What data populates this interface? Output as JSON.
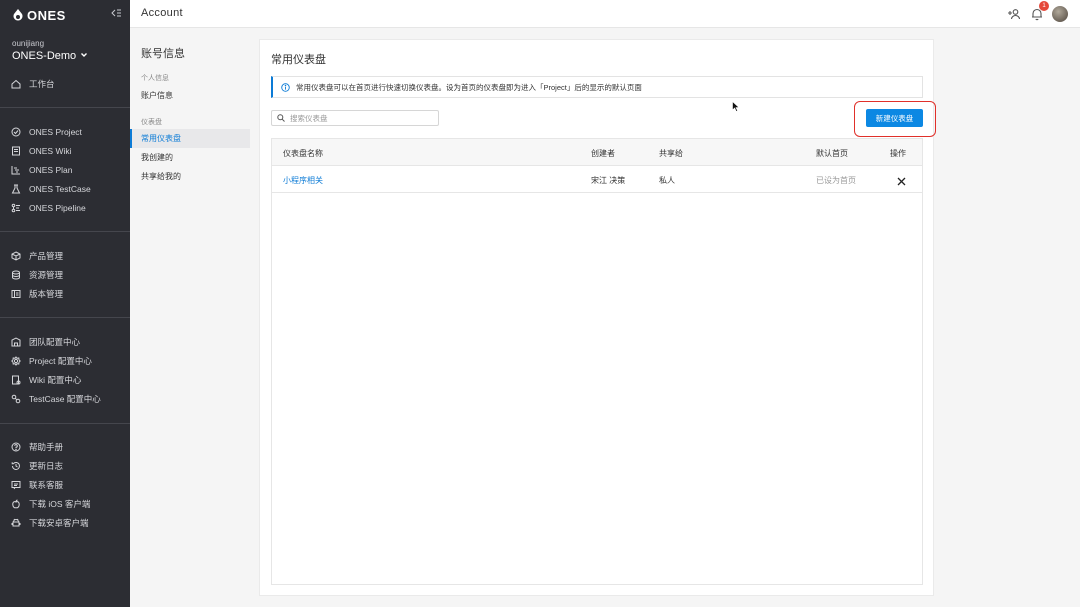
{
  "sidebar": {
    "logo_text": "ONES",
    "user_name": "ounijiang",
    "org_name": "ONES-Demo",
    "items": [
      {
        "label": "工作台",
        "icon": "home-icon"
      },
      {
        "label": "ONES Project",
        "icon": "project-icon"
      },
      {
        "label": "ONES Wiki",
        "icon": "wiki-icon"
      },
      {
        "label": "ONES Plan",
        "icon": "plan-icon"
      },
      {
        "label": "ONES TestCase",
        "icon": "testcase-icon"
      },
      {
        "label": "ONES Pipeline",
        "icon": "pipeline-icon"
      },
      {
        "label": "产品管理",
        "icon": "product-icon"
      },
      {
        "label": "资源管理",
        "icon": "resource-icon"
      },
      {
        "label": "版本管理",
        "icon": "version-icon"
      },
      {
        "label": "团队配置中心",
        "icon": "team-config-icon"
      },
      {
        "label": "Project 配置中心",
        "icon": "settings-icon"
      },
      {
        "label": "Wiki 配置中心",
        "icon": "wiki-config-icon"
      },
      {
        "label": "TestCase 配置中心",
        "icon": "testcase-config-icon"
      },
      {
        "label": "帮助手册",
        "icon": "help-icon"
      },
      {
        "label": "更新日志",
        "icon": "history-icon"
      },
      {
        "label": "联系客服",
        "icon": "message-icon"
      },
      {
        "label": "下载 iOS 客户端",
        "icon": "apple-icon"
      },
      {
        "label": "下载安卓客户端",
        "icon": "android-icon"
      }
    ]
  },
  "topbar": {
    "title": "Account",
    "notification_count": "1"
  },
  "subnav": {
    "title": "账号信息",
    "group_personal": "个人信息",
    "account_info": "账户信息",
    "group_dashboard": "仪表盘",
    "items": [
      "常用仪表盘",
      "我创建的",
      "共享给我的"
    ]
  },
  "main": {
    "title": "常用仪表盘",
    "info": "常用仪表盘可以在首页进行快速切换仪表盘。设为首页的仪表盘即为进入「Project」后的显示的默认页面",
    "search_placeholder": "搜索仪表盘",
    "new_button": "新建仪表盘",
    "columns": [
      "仪表盘名称",
      "创建者",
      "共享给",
      "默认首页",
      "操作"
    ],
    "rows": [
      {
        "name": "小程序相关",
        "creator": "宋江 决策",
        "shared": "私人",
        "default": "已设为首页"
      }
    ]
  },
  "colors": {
    "accent": "#0c88e3",
    "sidebar_bg": "#2c2d33",
    "highlight_frame": "#e0302a"
  }
}
